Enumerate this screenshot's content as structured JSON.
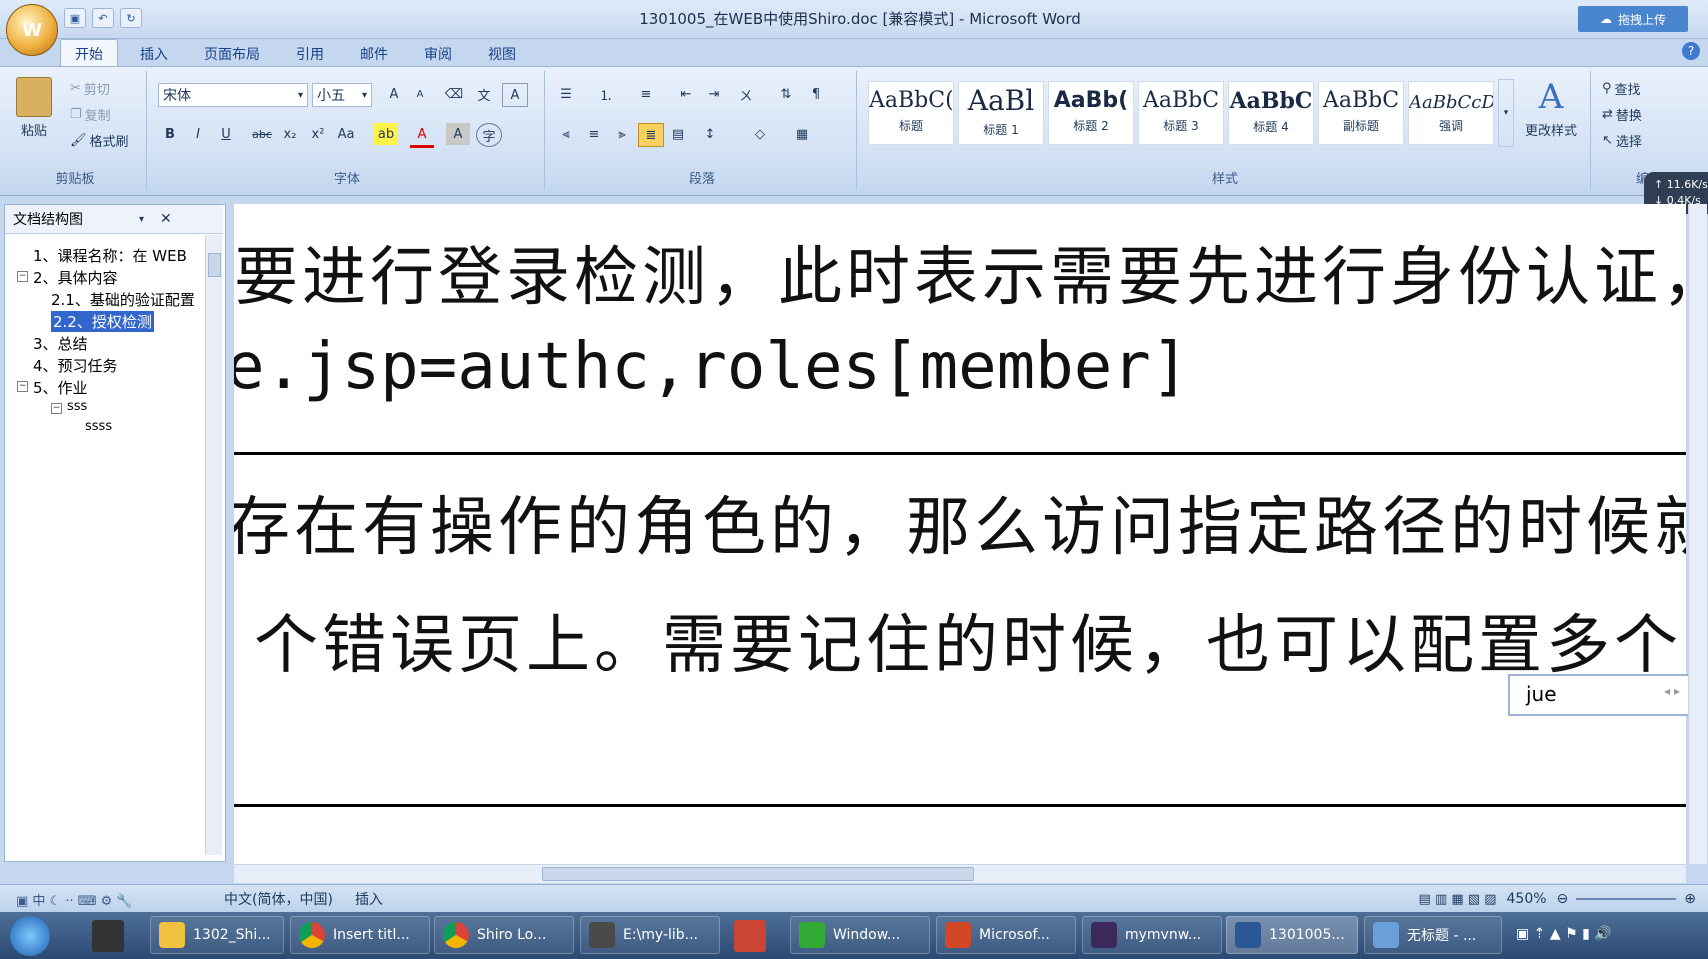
{
  "window": {
    "title": "1301005_在WEB中使用Shiro.doc [兼容模式] - Microsoft Word",
    "upload_label": "拖拽上传"
  },
  "tabs": [
    "开始",
    "插入",
    "页面布局",
    "引用",
    "邮件",
    "审阅",
    "视图"
  ],
  "ribbon": {
    "clipboard": {
      "label": "剪贴板",
      "paste": "粘贴",
      "cut": "剪切",
      "copy": "复制",
      "format_painter": "格式刷"
    },
    "font": {
      "label": "字体",
      "font_name": "宋体",
      "font_size": "小五",
      "bold": "B",
      "italic": "I",
      "underline": "U",
      "strike": "abc",
      "subscript": "x₂",
      "superscript": "x²",
      "change_case": "Aa",
      "grow": "A",
      "shrink": "A",
      "color_a": "A",
      "char_shading": "A"
    },
    "paragraph": {
      "label": "段落"
    },
    "styles": {
      "label": "样式",
      "items": [
        {
          "sample": "AaBbC(",
          "name": "标题"
        },
        {
          "sample": "AaBl",
          "name": "标题 1"
        },
        {
          "sample": "AaBb(",
          "name": "标题 2"
        },
        {
          "sample": "AaBbC",
          "name": "标题 3"
        },
        {
          "sample": "AaBbC",
          "name": "标题 4"
        },
        {
          "sample": "AaBbC",
          "name": "副标题"
        },
        {
          "sample": "AaBbCcD",
          "name": "强调"
        }
      ],
      "change_styles": "更改样式"
    },
    "editing": {
      "label": "编辑",
      "find": "查找",
      "replace": "替换",
      "select": "选择"
    }
  },
  "network": {
    "up": "11.6K/s",
    "down": "0.4K/s"
  },
  "nav": {
    "title": "文档结构图",
    "items": [
      "1、课程名称：在 WEB",
      "2、具体内容",
      "2.1、基础的验证配置",
      "2.2、授权检测",
      "3、总结",
      "4、预习任务",
      "5、作业",
      "sss",
      "ssss"
    ]
  },
  "document": {
    "lines": [
      "要进行登录检测，此时表示需要先进行身份认证，",
      "e.jsp=authc,roles[member]",
      "存在有操作的角色的，那么访问指定路径的时候就",
      "个错误页上。需要记住的时候，也可以配置多个"
    ]
  },
  "ime": {
    "input": "jue"
  },
  "status": {
    "language": "中文(简体，中国)",
    "mode": "插入",
    "zoom": "450%"
  },
  "taskbar": {
    "items": [
      "1302_Shi...",
      "Insert titl...",
      "Shiro Lo...",
      "E:\\my-lib...",
      "Window...",
      "Microsof...",
      "mymvnw...",
      "1301005...",
      "无标题 - ..."
    ]
  }
}
